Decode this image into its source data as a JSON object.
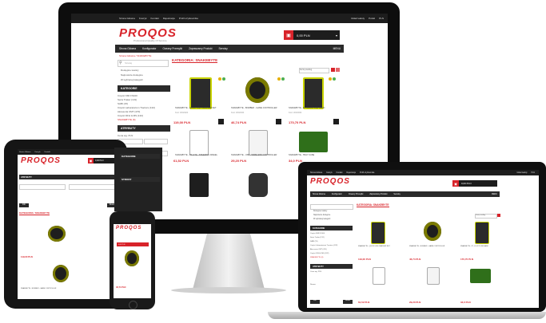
{
  "top_links": [
    "Strona Główna",
    "Koszyk",
    "Kontakt",
    "Rejestracja",
    "Profil użytkownika"
  ],
  "top_right": [
    "Układ waluty",
    "Polski",
    "PLN"
  ],
  "logo_text": "PROQOS",
  "logo_tagline": "Professional Quality Of Service",
  "cart": {
    "amount": "0,00 PLN"
  },
  "nav": [
    "Strona Główna",
    "Konfigurator",
    "Oceany Przesyłki",
    "Zapraszamy Produkt",
    "Serwisy"
  ],
  "menu_label": "MENU",
  "breadcrumb": "Strona Główna / SNAKEBYTE",
  "search_placeholder": "Szukaj",
  "filters": [
    "Dostępne towary",
    "Najnowsze dostępne",
    "W wybranej kategorii"
  ],
  "sidebar": {
    "categories_title": "KATEGORIE",
    "categories": [
      "Części KMI FS100",
      "Seria Traker (131)",
      "SABI (15)",
      "Części Laboratorium Tractors (132)",
      "Akcesoria CMT (470)",
      "Części DFH & MS (132)",
      "SNAKEBYTE (6)"
    ],
    "attributes_title": "ATRYBUTY",
    "attributes": [
      "Cena wg. PLN",
      "Nazwa"
    ],
    "filter_btn": "Filtr",
    "clear_btn": "Reset"
  },
  "tablet_sidebar": [
    "KATEGORIE",
    "STRONY"
  ],
  "category_title": "KATEGORIA: SNAKEBYTE",
  "sort_label": "Sortuj według",
  "products": [
    {
      "name": "SNAKEBYTE - QUICK USB CHARGER SET",
      "code": "Kod: 3002020",
      "price": "119,00 PLN"
    },
    {
      "name": "SNAKEBYTE - BOMBER - GAME CONTROLLER",
      "code": "Kod: 3002040",
      "price": "46,74 PLN"
    },
    {
      "name": "SNAKEBYTE - IP - KLUCZ USB NANO",
      "code": "Kod: 3002030",
      "price": "170,70 PLN"
    },
    {
      "name": "SNAKEBYTE - PS LITE - STEERING WHEEL",
      "code": "Kod: 3002050",
      "price": "61,52 PLN"
    },
    {
      "name": "SNAKEBYTE - USB - WIRELESS CONTROLLER",
      "code": "Kod: 3002060",
      "price": "29,20 PLN"
    },
    {
      "name": "SNAKEBYTE - TRAY CASE",
      "code": "Kod: 3002070",
      "price": "34,0 PLN"
    }
  ],
  "phone_product_price": "119,00 PLN",
  "phone_product_price2": "46,74 PLN",
  "colors": {
    "accent": "#d8232a",
    "dark": "#1d1d1d",
    "nav": "#2a2a2a"
  }
}
